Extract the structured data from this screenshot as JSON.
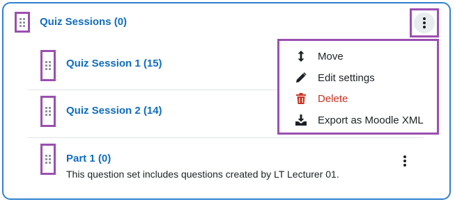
{
  "section": {
    "title": "Quiz Sessions (0)"
  },
  "items": [
    {
      "title": "Quiz Session 1 (15)"
    },
    {
      "title": "Quiz Session 2 (14)"
    },
    {
      "title": "Part 1 (0)",
      "description": "This question set includes questions created by LT Lecturer 01."
    }
  ],
  "menu": {
    "items": [
      {
        "label": "Move",
        "icon": "arrows-vertical-icon"
      },
      {
        "label": "Edit settings",
        "icon": "pencil-icon"
      },
      {
        "label": "Delete",
        "icon": "trash-icon",
        "color": "#ca3120"
      },
      {
        "label": "Export as Moodle XML",
        "icon": "download-icon"
      }
    ]
  },
  "colors": {
    "link": "#0f6cbf",
    "highlight": "#9b4fb0",
    "danger": "#ca3120",
    "border": "#2f7fd0"
  }
}
